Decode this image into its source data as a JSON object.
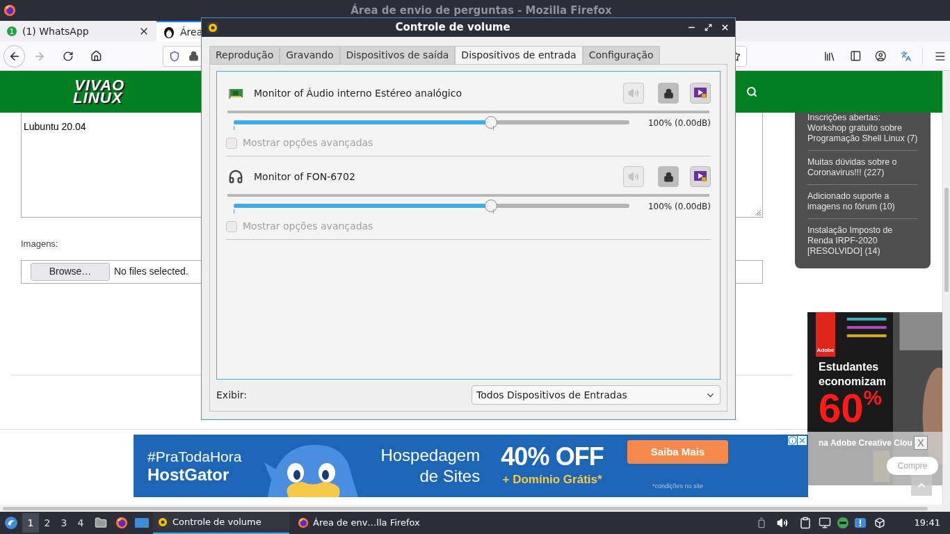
{
  "window": {
    "title": "Área de envio de perguntas - Mozilla Firefox"
  },
  "browser": {
    "tabs": [
      {
        "label": "(1) WhatsApp",
        "badge": "1",
        "selected": false
      },
      {
        "label": "Área",
        "selected": true
      }
    ]
  },
  "page": {
    "logo": [
      "VIVAO",
      "LINUX"
    ],
    "question_text": "Lubuntu 20.04",
    "images_label": "Imagens:",
    "browse_button": "Browse…",
    "file_status": "No files selected.",
    "sidebar_items": [
      "Inscrições abertas: Workshop gratuito sobre Programação Shell Linux (7)",
      "Muitas dúvidas sobre o Coronavirus!!! (227)",
      "Adicionado suporte a imagens no fórum (10)",
      "Instalação Imposto de Renda IRPF-2020 [RESOLVIDO] (14)"
    ]
  },
  "banner_ad": {
    "hashtag": "#PraTodaHora",
    "brand": "HostGator",
    "headline": [
      "Hospedagem",
      "de Sites"
    ],
    "offer": "40% OFF",
    "extra": "+ Domínio Grátis*",
    "button": "Saiba Mais",
    "footnote": "*condições no site"
  },
  "side_ad": {
    "brand": "Adobe",
    "headline": [
      "Estudantes",
      "economizam"
    ],
    "big_number": "60",
    "percent": "%",
    "caption": "na Adobe Creative Clou",
    "close": "X",
    "button": "Compre"
  },
  "volume_dialog": {
    "title": "Controle de volume",
    "tabs": [
      {
        "label": "Reprodução",
        "selected": false
      },
      {
        "label": "Gravando",
        "selected": false
      },
      {
        "label": "Dispositivos de saída",
        "selected": false
      },
      {
        "label": "Dispositivos de entrada",
        "selected": true
      },
      {
        "label": "Configuração",
        "selected": false
      }
    ],
    "devices": [
      {
        "kind": "card",
        "name": "Monitor of Áudio interno Estéreo analógico",
        "level": 0.65,
        "reading": "100% (0.00dB)",
        "muted": false,
        "locked": true,
        "advanced": {
          "label": "Mostrar opções avançadas",
          "checked": false,
          "disabled": true
        }
      },
      {
        "kind": "headphones",
        "name": "Monitor of FON-6702",
        "level": 0.65,
        "reading": "100% (0.00dB)",
        "muted": false,
        "locked": true,
        "advanced": {
          "label": "Mostrar opções avançadas",
          "checked": false,
          "disabled": true
        }
      }
    ],
    "display_label": "Exibir:",
    "display_value": "Todos Dispositivos de Entradas"
  },
  "taskbar": {
    "workspaces": [
      {
        "label": "1",
        "selected": true
      },
      {
        "label": "2",
        "selected": false
      },
      {
        "label": "3",
        "selected": false
      },
      {
        "label": "4",
        "selected": false
      }
    ],
    "tasks": [
      {
        "kind": "volume",
        "label": "Controle de volume",
        "selected": true
      },
      {
        "kind": "firefox",
        "label": "Área de env…lla Firefox",
        "selected": false
      }
    ],
    "clock": "19:41"
  }
}
